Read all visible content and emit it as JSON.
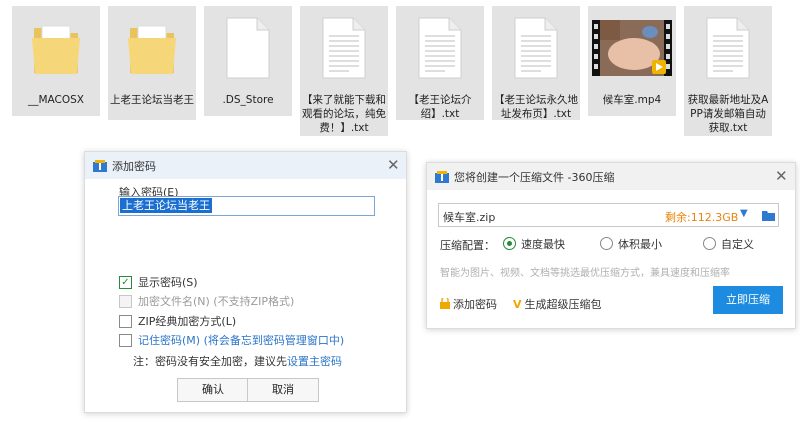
{
  "files": [
    {
      "name": "__MACOSX",
      "icon": "folder-icon"
    },
    {
      "name": "上老王论坛当老王",
      "icon": "folder-icon"
    },
    {
      "name": ".DS_Store",
      "icon": "blank-file-icon"
    },
    {
      "name": "【来了就能下载和观看的论坛，纯免费！】.txt",
      "icon": "text-file-icon"
    },
    {
      "name": "【老王论坛介绍】.txt",
      "icon": "text-file-icon"
    },
    {
      "name": "【老王论坛永久地址发布页】.txt",
      "icon": "text-file-icon"
    },
    {
      "name": "候车室.mp4",
      "icon": "video-thumbnail"
    },
    {
      "name": "获取最新地址及APP请发邮箱自动获取.txt",
      "icon": "text-file-icon"
    }
  ],
  "password_dialog": {
    "title": "添加密码",
    "input_label": "输入密码(E)",
    "password_value": "上老王论坛当老王",
    "show_password": "显示密码(S)",
    "encrypt_filenames": "加密文件名(N) (不支持ZIP格式)",
    "zip_classic": "ZIP经典加密方式(L)",
    "remember_password": "记住密码(M) (将会备忘到密码管理窗口中)",
    "note_prefix": "注：密码没有安全加密，建议先",
    "note_link": "设置主密码",
    "ok": "确认",
    "cancel": "取消"
  },
  "compress_dialog": {
    "title": "您将创建一个压缩文件 -360压缩",
    "filename": "候车室.zip",
    "remaining": "剩余:112.3GB",
    "config_label": "压缩配置：",
    "option_fast": "速度最快",
    "option_small": "体积最小",
    "option_custom": "自定义",
    "hint": "智能为图片、视频、文档等挑选最优压缩方式，兼具速度和压缩率",
    "add_password": "添加密码",
    "super_zip": "生成超级压缩包",
    "compress_now": "立即压缩"
  },
  "colors": {
    "accent_blue": "#1d8ce0",
    "remaining_orange": "#e8840a",
    "check_green": "#2a8a3a"
  }
}
